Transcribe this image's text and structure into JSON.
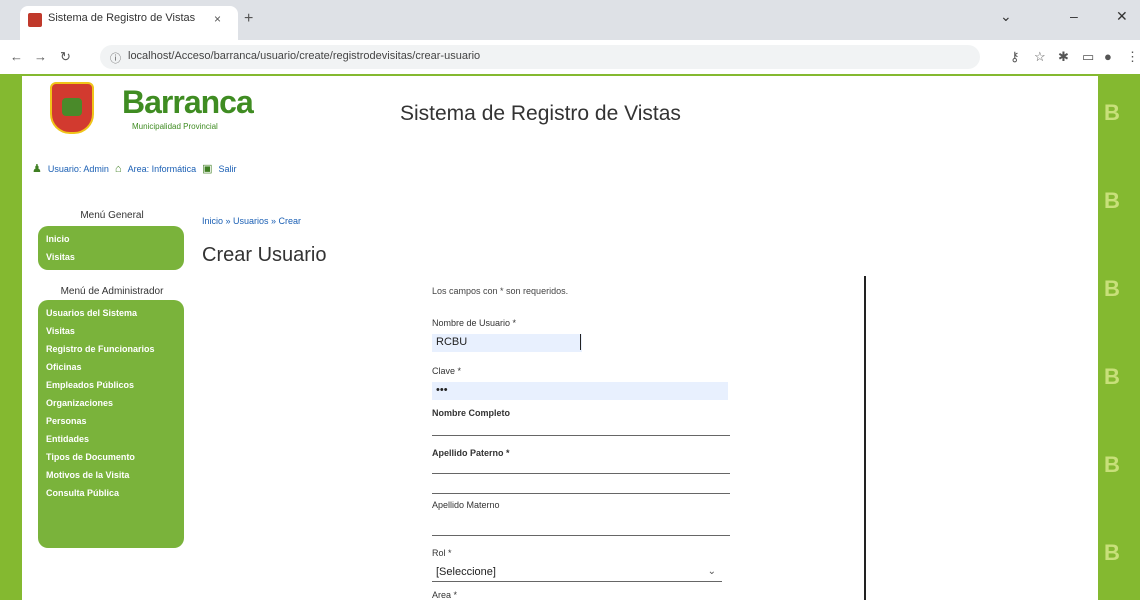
{
  "browser": {
    "tab_title": "Sistema de Registro de Vistas",
    "tab_close": "×",
    "new_tab": "+",
    "url": "localhost/Acceso/barranca/usuario/create/registrodevisitas/crear-usuario",
    "window_controls": [
      "⌄",
      "–",
      "✕"
    ]
  },
  "header": {
    "logo_text": "Barranca",
    "logo_subtitle": "Municipalidad Provincial",
    "system_title": "Sistema de Registro de Vistas"
  },
  "userbar": {
    "user": "Usuario: Admin",
    "area": "Area: Informática",
    "exit": "Salir"
  },
  "sidebar": {
    "general_title": "Menú General",
    "general_items": [
      "Inicio",
      "Visitas"
    ],
    "admin_title": "Menú de Administrador",
    "admin_items": [
      "Usuarios del Sistema",
      "Visitas",
      "Registro de Funcionarios",
      "Oficinas",
      "Empleados Públicos",
      "Organizaciones",
      "Personas",
      "Entidades",
      "Tipos de Documento",
      "Motivos de la Visita",
      "Consulta Pública"
    ]
  },
  "main": {
    "breadcrumb": "Inicio » Usuarios » Crear",
    "heading": "Crear Usuario"
  },
  "form": {
    "required_note": "Los campos con * son requeridos.",
    "username_label": "Nombre de Usuario *",
    "username_value": "RCBU",
    "password_label": "Clave *",
    "password_value": "•••",
    "fullname_label": "Nombre Completo",
    "lastname1_label": "Apellido Paterno *",
    "lastname2_label": "Apellido Materno",
    "role_label": "Rol *",
    "role_value": "[Seleccione]",
    "area_label": "Area *"
  },
  "colors": {
    "brand_green": "#84b930",
    "menu_green": "#7ab33b",
    "logo_green": "#3f8c22",
    "link_blue": "#1a5fb4"
  }
}
